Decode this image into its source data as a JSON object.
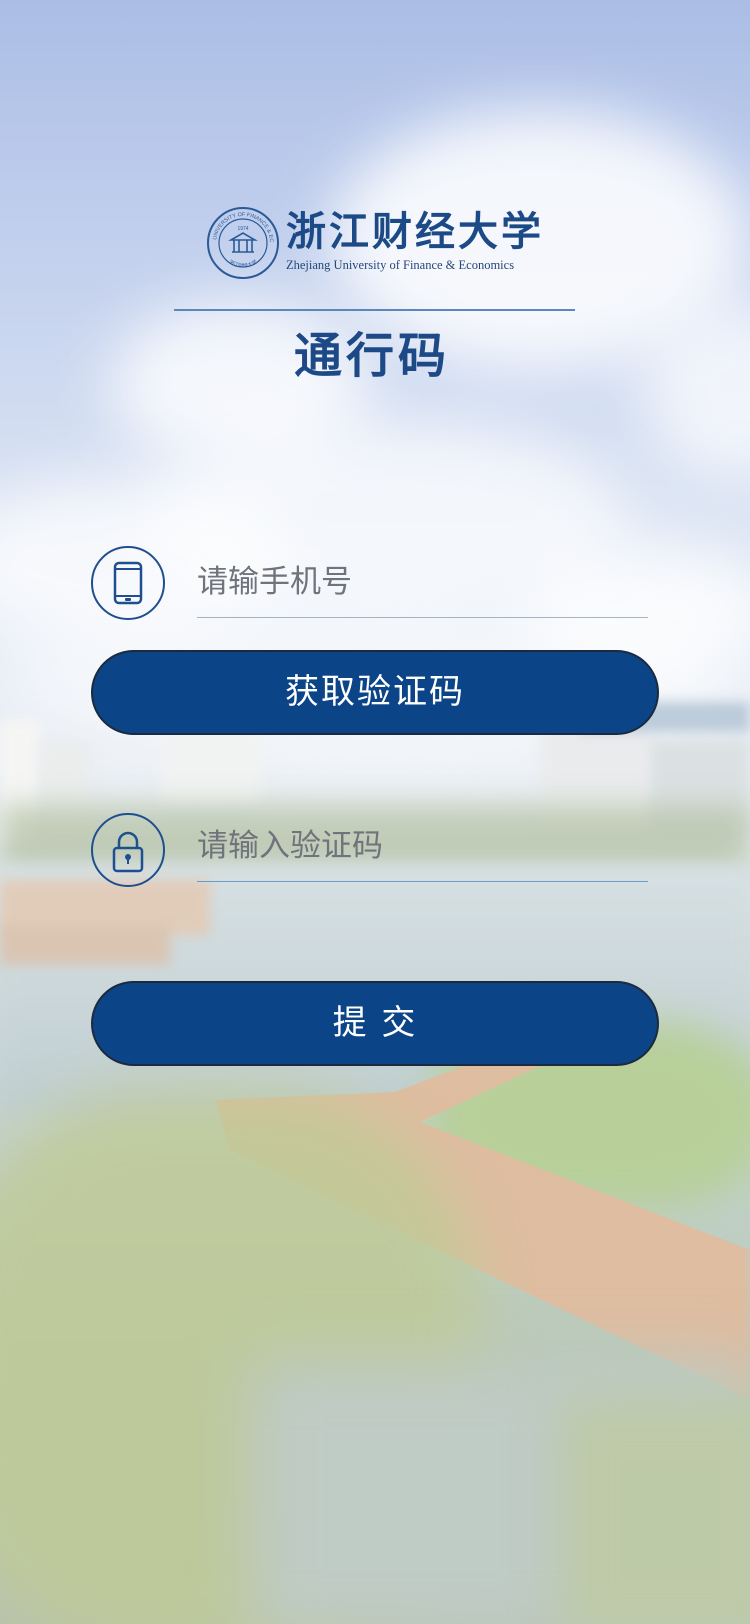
{
  "logo": {
    "name_cn": "浙江财经大学",
    "name_en": "Zhejiang University of Finance & Economics",
    "seal_year": "1974",
    "seal_ring_text": "ZHEJIANG UNIVERSITY OF FINANCE & ECONOMICS",
    "seal_ring_bottom": "浙江财经大学"
  },
  "page_title": "通行码",
  "phone": {
    "icon": "phone-icon",
    "placeholder": "请输手机号"
  },
  "get_code_button": {
    "label": "获取验证码"
  },
  "code": {
    "icon": "lock-icon",
    "placeholder": "请输入验证码"
  },
  "submit_button": {
    "label": "提 交"
  },
  "colors": {
    "primary": "#0c4488",
    "title": "#1d4a87",
    "icon_stroke": "#1f4f8e"
  }
}
